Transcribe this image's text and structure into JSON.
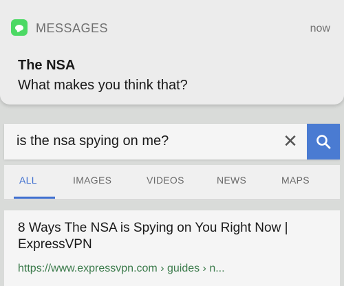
{
  "notification": {
    "app_name": "MESSAGES",
    "time": "now",
    "sender": "The NSA",
    "message": "What makes you think that?",
    "app_icon": "messages-icon"
  },
  "search": {
    "query": "is the nsa spying on me?",
    "clear_icon": "✕",
    "search_icon": "search-icon"
  },
  "tabs": [
    {
      "label": "ALL",
      "active": true
    },
    {
      "label": "IMAGES",
      "active": false
    },
    {
      "label": "VIDEOS",
      "active": false
    },
    {
      "label": "NEWS",
      "active": false
    },
    {
      "label": "MAPS",
      "active": false
    }
  ],
  "result": {
    "title": "8 Ways The NSA is Spying on You Right Now | ExpressVPN",
    "url": "https://www.expressvpn.com › guides › n..."
  },
  "colors": {
    "accent": "#4a7bd2",
    "messages_green": "#4cd964",
    "url_green": "#3a7a4a"
  }
}
